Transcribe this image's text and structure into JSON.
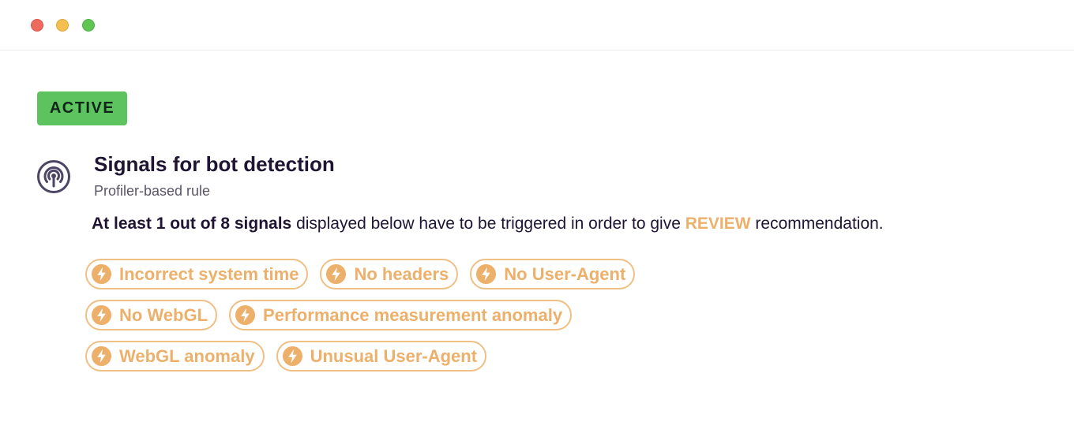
{
  "window": {
    "controls": {
      "close": "close",
      "minimize": "minimize",
      "zoom": "zoom"
    }
  },
  "status": {
    "label": "ACTIVE",
    "color": "#5cc35e"
  },
  "rule": {
    "icon": "broadcast-signal-icon",
    "title": "Signals for bot detection",
    "subtitle": "Profiler-based rule",
    "description": {
      "emphasis": "At least 1 out of 8 signals",
      "middle": " displayed below have to be triggered in order to give ",
      "recommendation": "REVIEW",
      "end": " recommendation."
    }
  },
  "signals": {
    "icon": "lightning-bolt-icon",
    "accent_color": "#edb06b",
    "rows": [
      [
        {
          "label": "Incorrect system time"
        },
        {
          "label": "No headers"
        },
        {
          "label": "No User-Agent"
        }
      ],
      [
        {
          "label": "No WebGL"
        },
        {
          "label": "Performance measurement anomaly"
        }
      ],
      [
        {
          "label": "WebGL anomaly"
        },
        {
          "label": "Unusual User-Agent"
        }
      ]
    ]
  }
}
